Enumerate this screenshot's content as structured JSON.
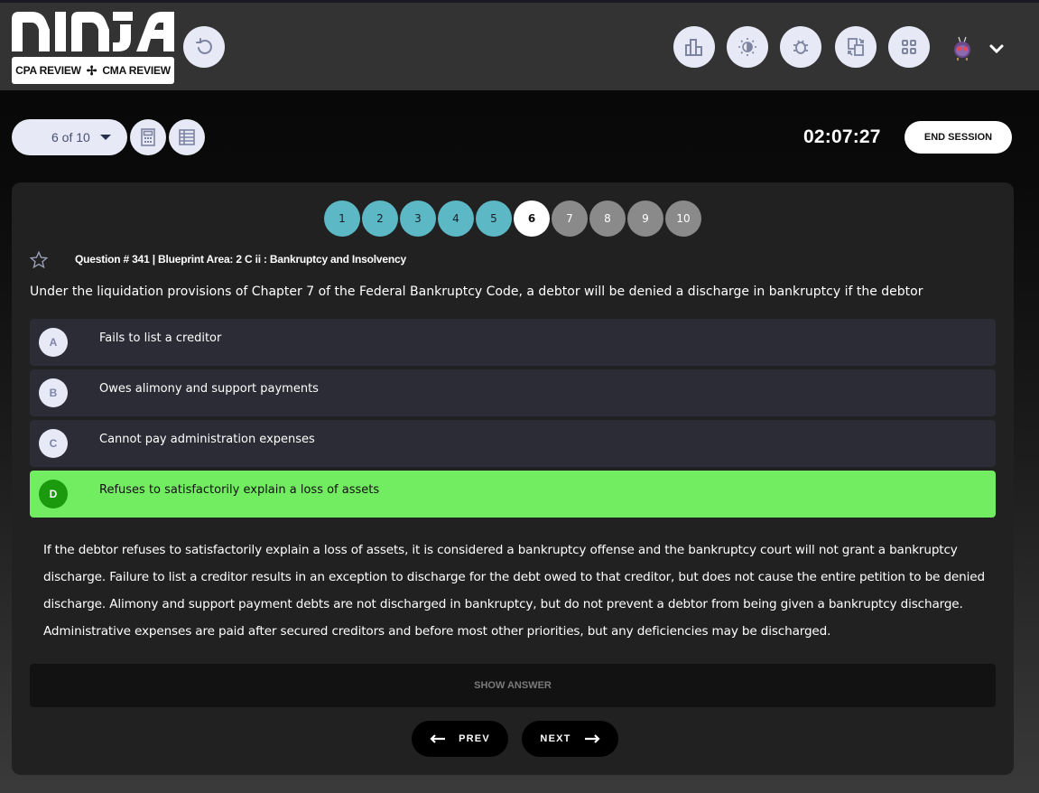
{
  "brand": {
    "wordmark": "NINJA",
    "badge_left": "CPA REVIEW",
    "badge_right": "CMA REVIEW"
  },
  "header": {
    "icons": [
      "reset-icon",
      "stats-icon",
      "theme-icon",
      "bug-report-icon",
      "switch-icon",
      "apps-grid-icon"
    ],
    "avatar": "venonat-avatar",
    "menu": "chevron-down-icon"
  },
  "toolbar": {
    "question_selector": "6 of 10",
    "timer": "02:07:27",
    "end_session_label": "END SESSION"
  },
  "colors": {
    "done": "#5bb8c4",
    "current": "#ffffff",
    "todo": "#8a8a8a",
    "correct_bg": "#72ec61",
    "correct_badge": "#1c9a0e"
  },
  "pager": [
    {
      "label": "1",
      "state": "done"
    },
    {
      "label": "2",
      "state": "done"
    },
    {
      "label": "3",
      "state": "done"
    },
    {
      "label": "4",
      "state": "done"
    },
    {
      "label": "5",
      "state": "done"
    },
    {
      "label": "6",
      "state": "current"
    },
    {
      "label": "7",
      "state": "todo"
    },
    {
      "label": "8",
      "state": "todo"
    },
    {
      "label": "9",
      "state": "todo"
    },
    {
      "label": "10",
      "state": "todo"
    }
  ],
  "question": {
    "meta": "Question # 341 | Blueprint Area: 2 C ii : Bankruptcy and Insolvency",
    "text": "Under the liquidation provisions of Chapter 7 of the Federal Bankruptcy Code, a debtor will be denied a discharge in bankruptcy if the debtor",
    "options": [
      {
        "letter": "A",
        "text": "Fails to list a creditor",
        "correct": false
      },
      {
        "letter": "B",
        "text": "Owes alimony and support payments",
        "correct": false
      },
      {
        "letter": "C",
        "text": "Cannot pay administration expenses",
        "correct": false
      },
      {
        "letter": "D",
        "text": "Refuses to satisfactorily explain a loss of assets",
        "correct": true
      }
    ],
    "explanation": "If the debtor refuses to satisfactorily explain a loss of assets, it is considered a bankruptcy offense and the bankruptcy court will not grant a bankruptcy discharge. Failure to list a creditor results in an exception to discharge for the debt owed to that creditor, but does not cause the entire petition to be denied discharge. Alimony and support payment debts are not discharged in bankruptcy, but do not prevent a debtor from being given a bankruptcy discharge. Administrative expenses are paid after secured creditors and before most other priorities, but any deficiencies may be discharged."
  },
  "actions": {
    "show_answer": "SHOW ANSWER",
    "prev": "PREV",
    "next": "NEXT"
  }
}
